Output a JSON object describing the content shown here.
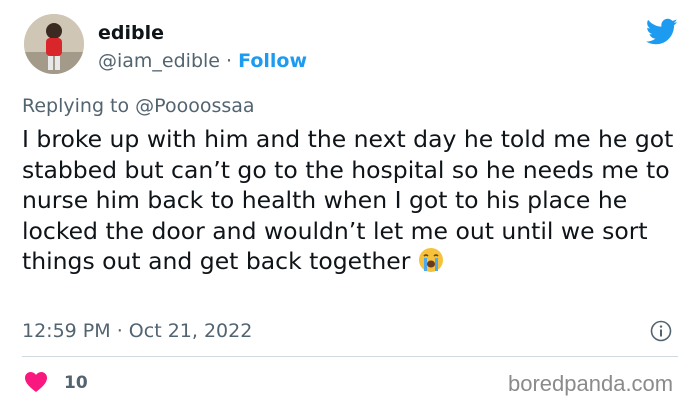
{
  "author": {
    "display_name": "edible",
    "handle": "@iam_edible",
    "separator": "·",
    "follow_label": "Follow"
  },
  "tweet": {
    "replying_to_prefix": "Replying to",
    "replying_to_handle": "@Poooossaa",
    "text": "I broke up with him and the next day he told me he got stabbed but can’t go to the hospital so he needs me to nurse him back to health when I got to his place he locked the door and wouldn’t let me out until we sort things out and get back together",
    "emoji": "crying-face-emoji",
    "time": "12:59 PM",
    "separator": "·",
    "date": "Oct 21, 2022",
    "like_count": "10"
  },
  "watermark": "boredpanda.com",
  "colors": {
    "twitter_blue": "#1d9bf0",
    "heart_pink": "#f91880",
    "text_primary": "#0f1419",
    "text_secondary": "#536471",
    "divider": "#cfd9de"
  },
  "icons": [
    "twitter-bird-icon",
    "info-icon",
    "heart-icon"
  ]
}
